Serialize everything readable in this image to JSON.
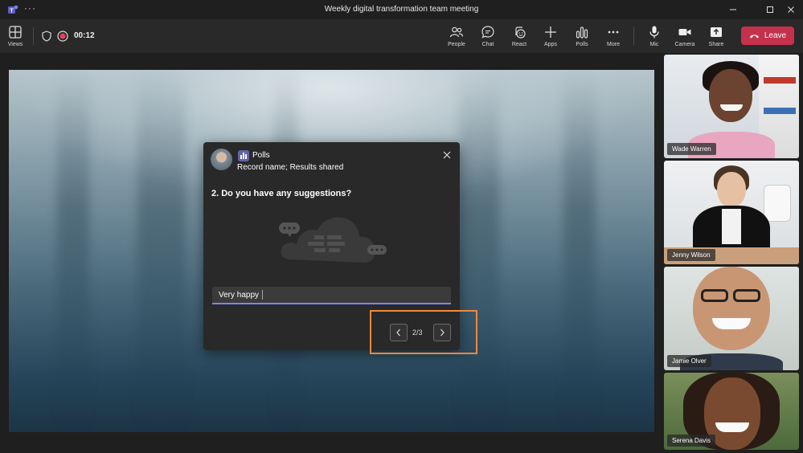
{
  "window": {
    "title": "Weekly digital transformation team meeting",
    "menu_dots": "···",
    "controls": [
      "minimize",
      "maximize",
      "close"
    ]
  },
  "toolbar": {
    "views_label": "Views",
    "timer": "00:12",
    "people_label": "People",
    "chat_label": "Chat",
    "react_label": "React",
    "apps_label": "Apps",
    "polls_label": "Polls",
    "more_label": "More",
    "mic_label": "Mic",
    "camera_label": "Camera",
    "share_label": "Share",
    "leave_label": "Leave"
  },
  "poll": {
    "app_name": "Polls",
    "subtitle": "Record name; Results shared",
    "question": "2. Do you have any suggestions?",
    "answer_value": "Very happy",
    "page_indicator": "2/3"
  },
  "participants": [
    {
      "name": "Wade Warren"
    },
    {
      "name": "Jenny Wilson"
    },
    {
      "name": "Jamie Olver"
    },
    {
      "name": "Serena Davis"
    }
  ],
  "colors": {
    "leave_button": "#c4314b",
    "accent": "#7f85f5",
    "highlight_box": "#f0883e",
    "polls_icon": "#6264a7"
  }
}
